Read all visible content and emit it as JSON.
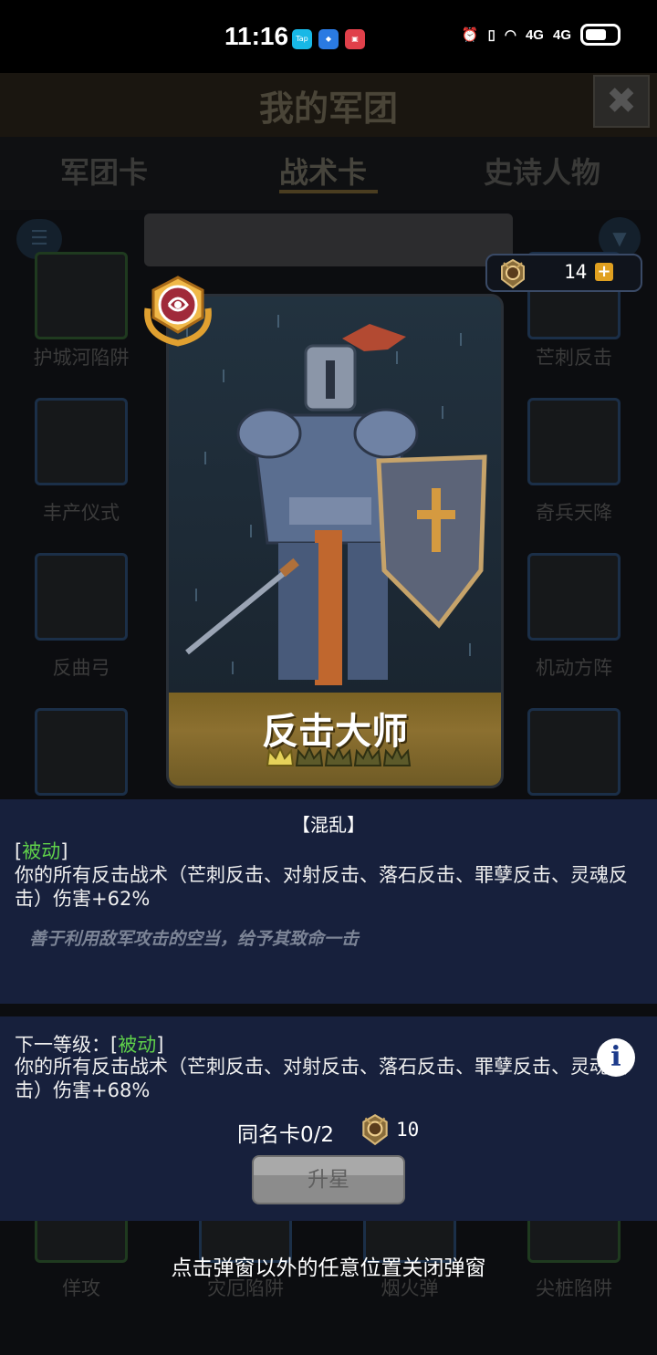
{
  "status_bar": {
    "time": "11:16",
    "app_icons": [
      "TapTap",
      "app",
      "HUAWEI"
    ],
    "network": [
      "4G",
      "4G"
    ]
  },
  "background": {
    "title": "我的军团",
    "close_icon": "close-icon",
    "tabs": [
      {
        "label": "军团卡",
        "active": false
      },
      {
        "label": "战术卡",
        "active": true
      },
      {
        "label": "史诗人物",
        "active": false
      }
    ],
    "cards": [
      {
        "label": "护城河陷阱"
      },
      {
        "label": "芒刺反击"
      },
      {
        "label": "丰产仪式"
      },
      {
        "label": "奇兵天降"
      },
      {
        "label": "反曲弓"
      },
      {
        "label": "机动方阵"
      },
      {
        "label": "佯攻"
      },
      {
        "label": "灾厄陷阱"
      },
      {
        "label": "烟火弹"
      },
      {
        "label": "尖桩陷阱"
      }
    ]
  },
  "coins": {
    "count": "14",
    "plus_label": "+"
  },
  "card": {
    "name": "反击大师",
    "stars_filled": 1,
    "stars_total": 5
  },
  "detail": {
    "tag": "【混乱】",
    "current": {
      "type_open": "[",
      "type": "被动",
      "type_close": "]",
      "desc": "你的所有反击战术（芒刺反击、对射反击、落石反击、罪孽反击、灵魂反击）伤害+62%"
    },
    "flavor": "善于利用敌军攻击的空当，给予其致命一击",
    "next": {
      "prefix": "下一等级：[",
      "type": "被动",
      "type_close": "]",
      "desc": "你的所有反击战术（芒刺反击、对射反击、落石反击、罪孽反击、灵魂反击）伤害+68%"
    },
    "same_card": "同名卡0/2",
    "cost": "10",
    "upgrade_label": "升星"
  },
  "hint": "点击弹窗以外的任意位置关闭弹窗",
  "colors": {
    "passive": "#5fd14a",
    "panel": "#17203c",
    "card_footer": "#8c7030"
  }
}
